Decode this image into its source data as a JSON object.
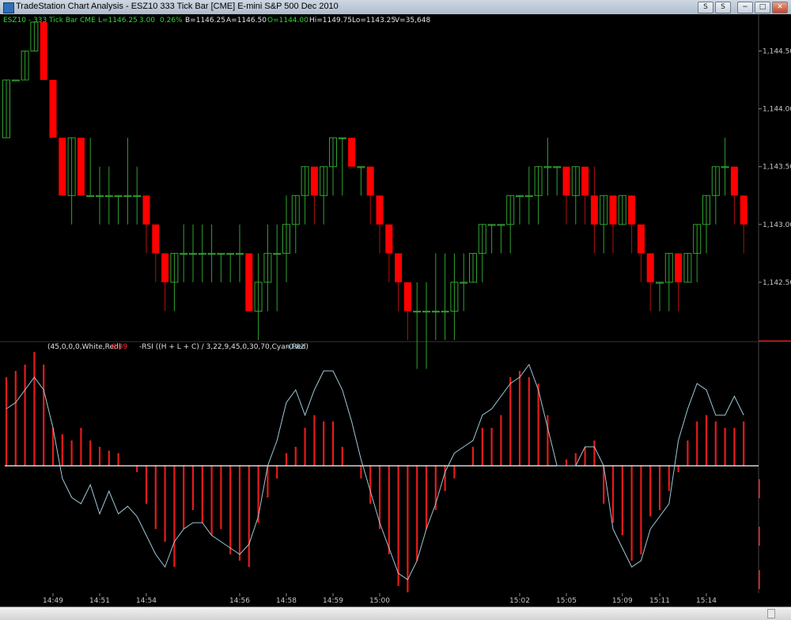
{
  "window": {
    "title": "TradeStation Chart Analysis - ESZ10 333 Tick Bar [CME] E-mini S&P 500 Dec 2010",
    "buttons": [
      "S",
      "S",
      "−",
      "□",
      "✕"
    ]
  },
  "header": {
    "symbol": "ESZ10 - 333 Tick Bar  CME",
    "last": "L=1146.25",
    "change": "3.00",
    "change_pct": "0.26%",
    "bid": "B=1146.25",
    "ask": "A=1146.50",
    "open": "O=1144.00",
    "high": "Hi=1149.75",
    "low": "Lo=1143.25",
    "volume": "V=35,648"
  },
  "indicator": {
    "params_macd": "(45,0,0,0,White,Red)",
    "value_macd": "0.09",
    "params_rsi": "-RSI ((H + L + C) / 3,22,9,45,0,30,70,Cyan,Red)",
    "value_rsi": "-0.82"
  },
  "colors": {
    "up": "#31a330",
    "down": "#ff0000",
    "rsi_line": "#9ec8d8",
    "hist": "#e81a1a",
    "axis_text": "#c8c8c8",
    "header_green": "#34d334"
  },
  "chart_data": [
    {
      "type": "candlestick",
      "price_ticks": [
        "1,144.50",
        "1,144.00",
        "1,143.50",
        "1,143.00",
        "1,142.50"
      ],
      "price_tick_values": [
        1144.5,
        1144.0,
        1143.5,
        1143.0,
        1142.5
      ],
      "ylim": [
        1142.0,
        1144.75
      ],
      "time_labels": [
        "14:49",
        "14:51",
        "14:54",
        "14:56",
        "14:58",
        "14:59",
        "15:00",
        "15:02",
        "15:05",
        "15:09",
        "15:11",
        "15:14"
      ],
      "time_label_bars": [
        5,
        10,
        15,
        25,
        30,
        35,
        40,
        55,
        60,
        66,
        70,
        75
      ],
      "bars": [
        {
          "o": 1143.75,
          "h": 1144.25,
          "l": 1143.75,
          "c": 1144.25
        },
        {
          "o": 1144.25,
          "h": 1144.25,
          "l": 1144.25,
          "c": 1144.25
        },
        {
          "o": 1144.25,
          "h": 1144.5,
          "l": 1144.25,
          "c": 1144.5
        },
        {
          "o": 1144.5,
          "h": 1144.75,
          "l": 1144.5,
          "c": 1144.75
        },
        {
          "o": 1144.75,
          "h": 1144.75,
          "l": 1144.25,
          "c": 1144.25
        },
        {
          "o": 1144.25,
          "h": 1144.25,
          "l": 1143.75,
          "c": 1143.75
        },
        {
          "o": 1143.75,
          "h": 1143.75,
          "l": 1143.25,
          "c": 1143.25
        },
        {
          "o": 1143.25,
          "h": 1143.75,
          "l": 1143.0,
          "c": 1143.75
        },
        {
          "o": 1143.75,
          "h": 1143.75,
          "l": 1143.25,
          "c": 1143.25
        },
        {
          "o": 1143.25,
          "h": 1143.75,
          "l": 1143.25,
          "c": 1143.25
        },
        {
          "o": 1143.25,
          "h": 1143.5,
          "l": 1143.0,
          "c": 1143.25
        },
        {
          "o": 1143.25,
          "h": 1143.5,
          "l": 1143.0,
          "c": 1143.25
        },
        {
          "o": 1143.25,
          "h": 1143.25,
          "l": 1143.0,
          "c": 1143.25
        },
        {
          "o": 1143.25,
          "h": 1143.75,
          "l": 1143.0,
          "c": 1143.25
        },
        {
          "o": 1143.25,
          "h": 1143.5,
          "l": 1143.0,
          "c": 1143.25
        },
        {
          "o": 1143.25,
          "h": 1143.25,
          "l": 1142.75,
          "c": 1143.0
        },
        {
          "o": 1143.0,
          "h": 1143.0,
          "l": 1142.5,
          "c": 1142.75
        },
        {
          "o": 1142.75,
          "h": 1142.75,
          "l": 1142.25,
          "c": 1142.5
        },
        {
          "o": 1142.5,
          "h": 1142.75,
          "l": 1142.25,
          "c": 1142.75
        },
        {
          "o": 1142.75,
          "h": 1143.0,
          "l": 1142.5,
          "c": 1142.75
        },
        {
          "o": 1142.75,
          "h": 1143.0,
          "l": 1142.5,
          "c": 1142.75
        },
        {
          "o": 1142.75,
          "h": 1143.0,
          "l": 1142.5,
          "c": 1142.75
        },
        {
          "o": 1142.75,
          "h": 1143.0,
          "l": 1142.5,
          "c": 1142.75
        },
        {
          "o": 1142.75,
          "h": 1142.75,
          "l": 1142.5,
          "c": 1142.75
        },
        {
          "o": 1142.75,
          "h": 1142.75,
          "l": 1142.5,
          "c": 1142.75
        },
        {
          "o": 1142.75,
          "h": 1143.0,
          "l": 1142.5,
          "c": 1142.75
        },
        {
          "o": 1142.75,
          "h": 1142.75,
          "l": 1142.25,
          "c": 1142.25
        },
        {
          "o": 1142.25,
          "h": 1142.75,
          "l": 1142.0,
          "c": 1142.5
        },
        {
          "o": 1142.5,
          "h": 1143.0,
          "l": 1142.25,
          "c": 1142.75
        },
        {
          "o": 1142.75,
          "h": 1143.0,
          "l": 1142.25,
          "c": 1142.75
        },
        {
          "o": 1142.75,
          "h": 1143.25,
          "l": 1142.5,
          "c": 1143.0
        },
        {
          "o": 1143.0,
          "h": 1143.25,
          "l": 1142.75,
          "c": 1143.25
        },
        {
          "o": 1143.25,
          "h": 1143.5,
          "l": 1143.0,
          "c": 1143.5
        },
        {
          "o": 1143.5,
          "h": 1143.5,
          "l": 1143.0,
          "c": 1143.25
        },
        {
          "o": 1143.25,
          "h": 1143.5,
          "l": 1143.0,
          "c": 1143.5
        },
        {
          "o": 1143.5,
          "h": 1143.75,
          "l": 1143.25,
          "c": 1143.75
        },
        {
          "o": 1143.75,
          "h": 1143.75,
          "l": 1143.25,
          "c": 1143.75
        },
        {
          "o": 1143.75,
          "h": 1143.75,
          "l": 1143.5,
          "c": 1143.5
        },
        {
          "o": 1143.5,
          "h": 1143.5,
          "l": 1143.25,
          "c": 1143.5
        },
        {
          "o": 1143.5,
          "h": 1143.5,
          "l": 1143.0,
          "c": 1143.25
        },
        {
          "o": 1143.25,
          "h": 1143.25,
          "l": 1142.75,
          "c": 1143.0
        },
        {
          "o": 1143.0,
          "h": 1143.0,
          "l": 1142.5,
          "c": 1142.75
        },
        {
          "o": 1142.75,
          "h": 1142.75,
          "l": 1142.25,
          "c": 1142.5
        },
        {
          "o": 1142.5,
          "h": 1142.5,
          "l": 1142.0,
          "c": 1142.25
        },
        {
          "o": 1142.25,
          "h": 1142.5,
          "l": 1141.75,
          "c": 1142.25
        },
        {
          "o": 1142.25,
          "h": 1142.5,
          "l": 1141.75,
          "c": 1142.25
        },
        {
          "o": 1142.25,
          "h": 1142.75,
          "l": 1142.0,
          "c": 1142.25
        },
        {
          "o": 1142.25,
          "h": 1142.75,
          "l": 1142.0,
          "c": 1142.25
        },
        {
          "o": 1142.25,
          "h": 1142.75,
          "l": 1142.0,
          "c": 1142.5
        },
        {
          "o": 1142.5,
          "h": 1142.75,
          "l": 1142.25,
          "c": 1142.5
        },
        {
          "o": 1142.5,
          "h": 1142.75,
          "l": 1142.5,
          "c": 1142.75
        },
        {
          "o": 1142.75,
          "h": 1143.0,
          "l": 1142.5,
          "c": 1143.0
        },
        {
          "o": 1143.0,
          "h": 1143.0,
          "l": 1142.75,
          "c": 1143.0
        },
        {
          "o": 1143.0,
          "h": 1143.0,
          "l": 1142.75,
          "c": 1143.0
        },
        {
          "o": 1143.0,
          "h": 1143.25,
          "l": 1142.75,
          "c": 1143.25
        },
        {
          "o": 1143.25,
          "h": 1143.25,
          "l": 1143.0,
          "c": 1143.25
        },
        {
          "o": 1143.25,
          "h": 1143.5,
          "l": 1143.0,
          "c": 1143.25
        },
        {
          "o": 1143.25,
          "h": 1143.5,
          "l": 1143.0,
          "c": 1143.5
        },
        {
          "o": 1143.5,
          "h": 1143.75,
          "l": 1143.25,
          "c": 1143.5
        },
        {
          "o": 1143.5,
          "h": 1143.5,
          "l": 1143.25,
          "c": 1143.5
        },
        {
          "o": 1143.5,
          "h": 1143.5,
          "l": 1143.0,
          "c": 1143.25
        },
        {
          "o": 1143.25,
          "h": 1143.5,
          "l": 1143.0,
          "c": 1143.5
        },
        {
          "o": 1143.5,
          "h": 1143.5,
          "l": 1143.0,
          "c": 1143.25
        },
        {
          "o": 1143.25,
          "h": 1143.5,
          "l": 1142.75,
          "c": 1143.0
        },
        {
          "o": 1143.0,
          "h": 1143.25,
          "l": 1142.75,
          "c": 1143.25
        },
        {
          "o": 1143.25,
          "h": 1143.25,
          "l": 1142.75,
          "c": 1143.0
        },
        {
          "o": 1143.0,
          "h": 1143.25,
          "l": 1143.0,
          "c": 1143.25
        },
        {
          "o": 1143.25,
          "h": 1143.25,
          "l": 1142.75,
          "c": 1143.0
        },
        {
          "o": 1143.0,
          "h": 1143.0,
          "l": 1142.5,
          "c": 1142.75
        },
        {
          "o": 1142.75,
          "h": 1142.75,
          "l": 1142.25,
          "c": 1142.5
        },
        {
          "o": 1142.5,
          "h": 1142.5,
          "l": 1142.25,
          "c": 1142.5
        },
        {
          "o": 1142.5,
          "h": 1142.75,
          "l": 1142.25,
          "c": 1142.75
        },
        {
          "o": 1142.75,
          "h": 1142.75,
          "l": 1142.25,
          "c": 1142.5
        },
        {
          "o": 1142.5,
          "h": 1142.75,
          "l": 1142.5,
          "c": 1142.75
        },
        {
          "o": 1142.75,
          "h": 1143.0,
          "l": 1142.5,
          "c": 1143.0
        },
        {
          "o": 1143.0,
          "h": 1143.25,
          "l": 1142.75,
          "c": 1143.25
        },
        {
          "o": 1143.25,
          "h": 1143.5,
          "l": 1143.0,
          "c": 1143.5
        },
        {
          "o": 1143.5,
          "h": 1143.75,
          "l": 1143.25,
          "c": 1143.5
        },
        {
          "o": 1143.5,
          "h": 1143.5,
          "l": 1143.0,
          "c": 1143.25
        },
        {
          "o": 1143.25,
          "h": 1143.25,
          "l": 1142.75,
          "c": 1143.0
        }
      ]
    },
    {
      "type": "line",
      "name": "RSI",
      "ylim": [
        -1.0,
        1.0
      ],
      "values": [
        0.45,
        0.5,
        0.6,
        0.7,
        0.6,
        0.3,
        -0.1,
        -0.25,
        -0.3,
        -0.15,
        -0.38,
        -0.2,
        -0.38,
        -0.32,
        -0.4,
        -0.55,
        -0.7,
        -0.8,
        -0.6,
        -0.5,
        -0.45,
        -0.45,
        -0.55,
        -0.6,
        -0.65,
        -0.7,
        -0.62,
        -0.4,
        0.0,
        0.2,
        0.5,
        0.6,
        0.4,
        0.6,
        0.75,
        0.75,
        0.6,
        0.35,
        0.05,
        -0.2,
        -0.45,
        -0.65,
        -0.85,
        -0.9,
        -0.75,
        -0.5,
        -0.3,
        -0.05,
        0.1,
        0.15,
        0.2,
        0.4,
        0.45,
        0.55,
        0.65,
        0.7,
        0.8,
        0.6,
        0.3,
        0.0,
        0.0,
        0.0,
        0.15,
        0.15,
        0.0,
        -0.5,
        -0.65,
        -0.8,
        -0.75,
        -0.5,
        -0.4,
        -0.3,
        0.2,
        0.45,
        0.65,
        0.6,
        0.4,
        0.4,
        0.55,
        0.4
      ],
      "zero_value": 0
    },
    {
      "type": "bar",
      "name": "Histogram",
      "values": [
        0.7,
        0.75,
        0.8,
        0.9,
        0.8,
        0.3,
        0.25,
        0.2,
        0.3,
        0.2,
        0.15,
        0.12,
        0.1,
        0.0,
        -0.05,
        -0.3,
        -0.5,
        -0.6,
        -0.8,
        -0.5,
        -0.35,
        -0.45,
        -0.55,
        -0.5,
        -0.7,
        -0.75,
        -0.8,
        -0.45,
        -0.25,
        -0.1,
        0.1,
        0.15,
        0.3,
        0.4,
        0.35,
        0.35,
        0.15,
        0.0,
        -0.1,
        -0.3,
        -0.5,
        -0.7,
        -0.95,
        -1.0,
        -0.75,
        -0.5,
        -0.35,
        -0.2,
        -0.1,
        0.0,
        0.15,
        0.3,
        0.3,
        0.4,
        0.7,
        0.75,
        0.7,
        0.65,
        0.4,
        0.0,
        0.05,
        0.1,
        0.15,
        0.2,
        -0.3,
        -0.45,
        -0.55,
        -0.75,
        -0.7,
        -0.4,
        -0.35,
        -0.2,
        -0.05,
        0.2,
        0.35,
        0.4,
        0.35,
        0.3,
        0.3,
        0.35
      ],
      "zero_value": 0
    }
  ]
}
